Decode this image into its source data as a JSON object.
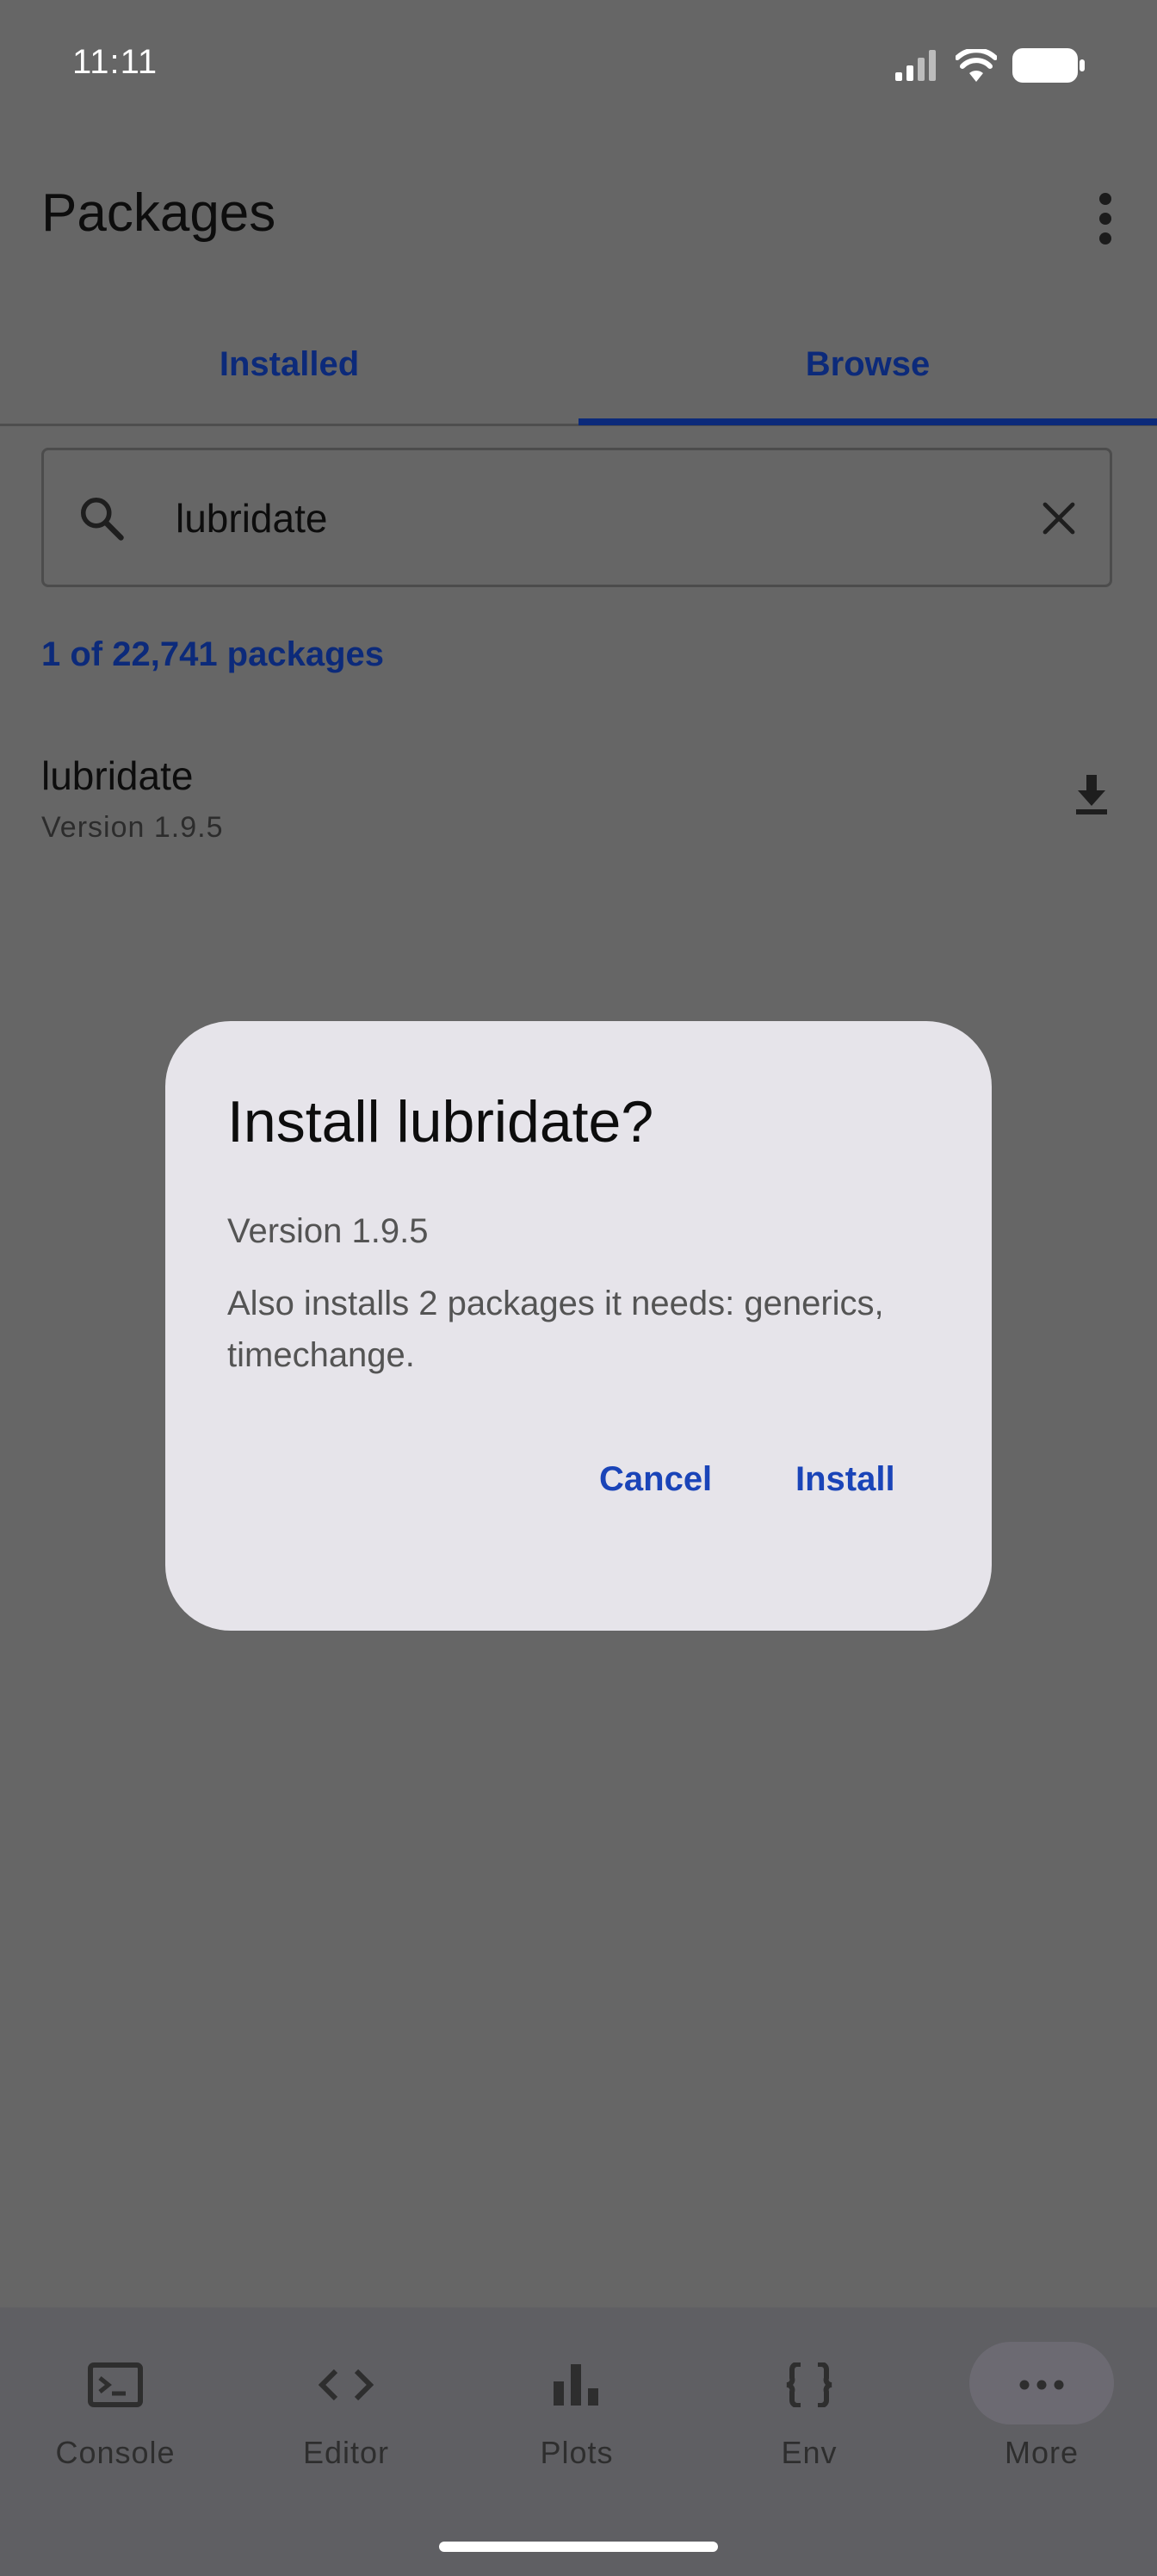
{
  "status_bar": {
    "time": "11:11"
  },
  "app_bar": {
    "title": "Packages"
  },
  "tabs": [
    {
      "label": "Installed",
      "selected": false
    },
    {
      "label": "Browse",
      "selected": true
    }
  ],
  "search": {
    "value": "lubridate"
  },
  "results": {
    "count_text": "1 of 22,741 packages"
  },
  "package": {
    "name": "lubridate",
    "version": "Version 1.9.5"
  },
  "dialog": {
    "title": "Install lubridate?",
    "version": "Version 1.9.5",
    "message": "Also installs 2 packages it needs: generics, timechange.",
    "cancel_label": "Cancel",
    "install_label": "Install"
  },
  "bottom_nav": [
    {
      "label": "Console",
      "icon": "console-icon"
    },
    {
      "label": "Editor",
      "icon": "code-icon"
    },
    {
      "label": "Plots",
      "icon": "bar-chart-icon"
    },
    {
      "label": "Env",
      "icon": "braces-icon"
    },
    {
      "label": "More",
      "icon": "more-horiz-icon",
      "selected": true
    }
  ],
  "colors": {
    "accent": "#0c2a7a",
    "dialog_button": "#1a44b8",
    "scrim_background": "#666666",
    "dialog_surface": "#e6e4ea"
  }
}
